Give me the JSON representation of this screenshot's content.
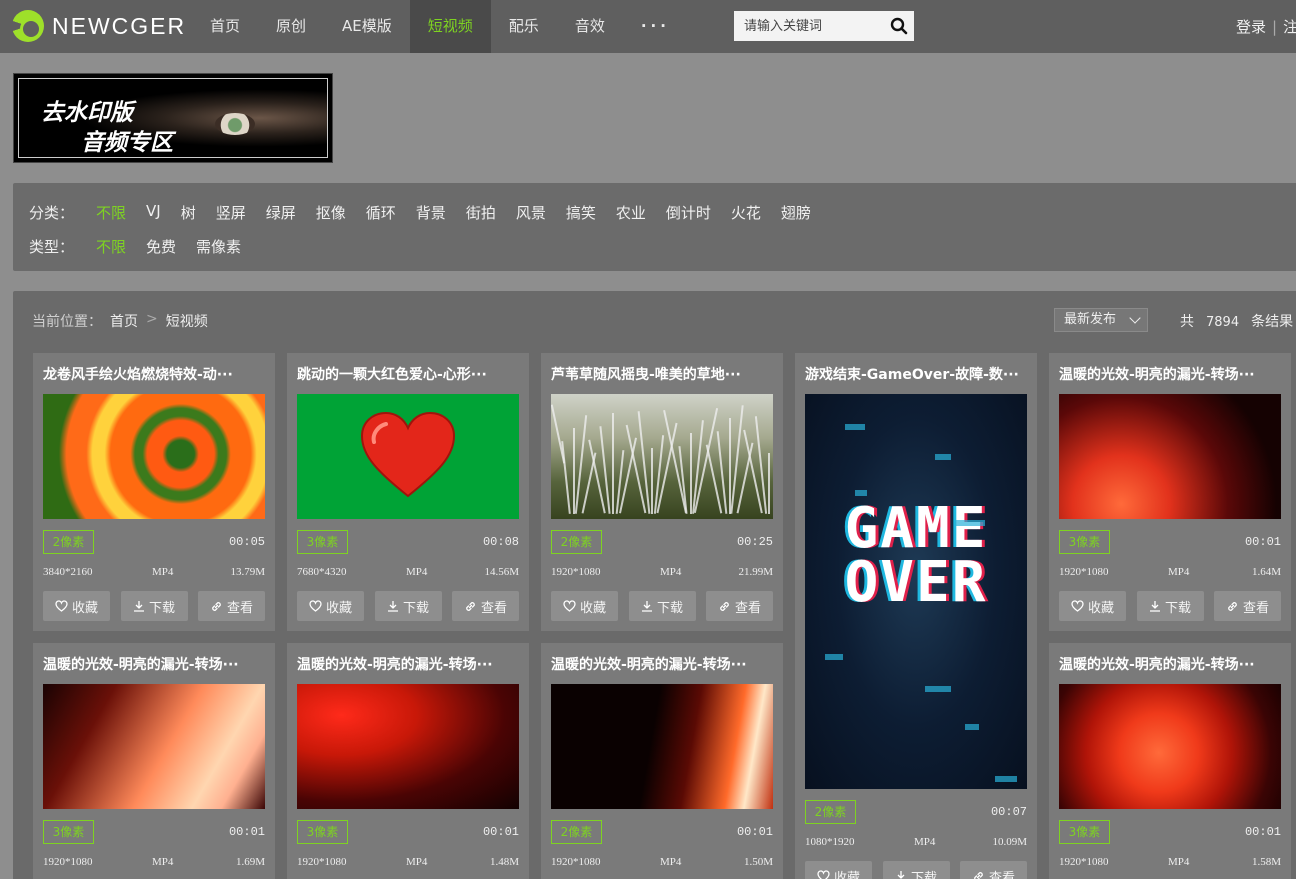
{
  "brand": {
    "name": "NEWCGER"
  },
  "nav": [
    "首页",
    "原创",
    "AE模版",
    "短视频",
    "配乐",
    "音效",
    "···"
  ],
  "nav_active_index": 3,
  "search": {
    "placeholder": "请输入关键词"
  },
  "auth": {
    "login": "登录",
    "register": "注"
  },
  "banner": {
    "line1": "去水印版",
    "line2": "音频专区"
  },
  "filters": {
    "category_label": "分类：",
    "categories": [
      "不限",
      "VJ",
      "树",
      "竖屏",
      "绿屏",
      "抠像",
      "循环",
      "背景",
      "街拍",
      "风景",
      "搞笑",
      "农业",
      "倒计时",
      "火花",
      "翅膀"
    ],
    "type_label": "类型：",
    "types": [
      "不限",
      "免费",
      "需像素"
    ]
  },
  "breadcrumb": {
    "label": "当前位置：",
    "home": "首页",
    "current": "短视频"
  },
  "sort": {
    "selected": "最新发布"
  },
  "results": {
    "prefix": "共",
    "count": "7894",
    "suffix": "条结果"
  },
  "buttons": {
    "favorite": "收藏",
    "download": "下载",
    "view": "查看"
  },
  "colors": {
    "accent": "#7ed321",
    "topbar": "#5f5f5f",
    "panel": "#6a6a6a",
    "card": "#7a7a7a"
  },
  "cards": [
    {
      "title": "龙卷风手绘火焰燃烧特效-动···",
      "badge": "2像素",
      "duration": "00:05",
      "resolution": "3840*2160",
      "format": "MP4",
      "size": "13.79M"
    },
    {
      "title": "跳动的一颗大红色爱心-心形···",
      "badge": "3像素",
      "duration": "00:08",
      "resolution": "7680*4320",
      "format": "MP4",
      "size": "14.56M"
    },
    {
      "title": "芦苇草随风摇曳-唯美的草地···",
      "badge": "2像素",
      "duration": "00:25",
      "resolution": "1920*1080",
      "format": "MP4",
      "size": "21.99M"
    },
    {
      "title": "游戏结束-GameOver-故障-数···",
      "badge": "2像素",
      "duration": "00:07",
      "resolution": "1080*1920",
      "format": "MP4",
      "size": "10.09M",
      "thumb_text": [
        "GAME",
        "OVER"
      ]
    },
    {
      "title": "温暖的光效-明亮的漏光-转场···",
      "badge": "3像素",
      "duration": "00:01",
      "resolution": "1920*1080",
      "format": "MP4",
      "size": "1.64M"
    },
    {
      "title": "温暖的光效-明亮的漏光-转场···",
      "badge": "3像素",
      "duration": "00:01",
      "resolution": "1920*1080",
      "format": "MP4",
      "size": "1.69M"
    },
    {
      "title": "温暖的光效-明亮的漏光-转场···",
      "badge": "3像素",
      "duration": "00:01",
      "resolution": "1920*1080",
      "format": "MP4",
      "size": "1.48M"
    },
    {
      "title": "温暖的光效-明亮的漏光-转场···",
      "badge": "2像素",
      "duration": "00:01",
      "resolution": "1920*1080",
      "format": "MP4",
      "size": "1.50M"
    },
    {
      "title": "温暖的光效-明亮的漏光-转场···",
      "badge": "3像素",
      "duration": "00:01",
      "resolution": "1920*1080",
      "format": "MP4",
      "size": "1.58M"
    }
  ]
}
